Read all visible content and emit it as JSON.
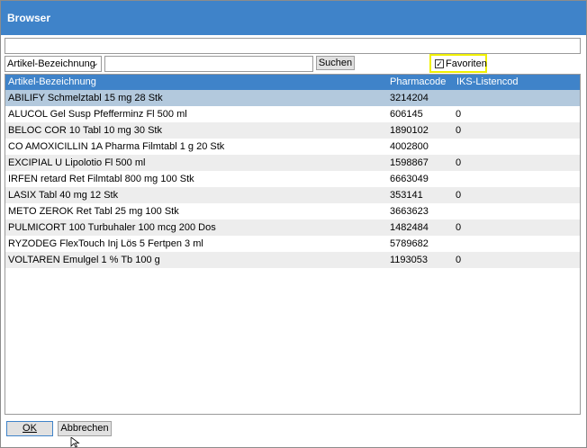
{
  "window": {
    "title": "Browser"
  },
  "top_input": {
    "value": ""
  },
  "filter": {
    "selected": "Artikel-Bezeichnung"
  },
  "search": {
    "value": "",
    "button_label": "Suchen"
  },
  "favorites": {
    "label": "Favoriten",
    "checked": true
  },
  "table": {
    "columns": [
      "Artikel-Bezeichnung",
      "Pharmacode",
      "IKS-Listencode"
    ],
    "rows": [
      [
        "ABILIFY Schmelztabl 15 mg 28 Stk",
        "3214204",
        ""
      ],
      [
        "ALUCOL Gel Susp Pfefferminz Fl 500 ml",
        "606145",
        "0"
      ],
      [
        "BELOC COR 10 Tabl 10 mg 30 Stk",
        "1890102",
        "0"
      ],
      [
        "CO AMOXICILLIN 1A Pharma Filmtabl 1 g 20 Stk",
        "4002800",
        ""
      ],
      [
        "EXCIPIAL U Lipolotio Fl 500 ml",
        "1598867",
        "0"
      ],
      [
        "IRFEN retard Ret Filmtabl 800 mg 100 Stk",
        "6663049",
        ""
      ],
      [
        "LASIX Tabl 40 mg 12 Stk",
        "353141",
        "0"
      ],
      [
        "METO ZEROK Ret Tabl 25 mg 100 Stk",
        "3663623",
        ""
      ],
      [
        "PULMICORT 100 Turbuhaler 100 mcg 200 Dos",
        "1482484",
        "0"
      ],
      [
        "RYZODEG FlexTouch Inj Lös 5 Fertpen 3 ml",
        "5789682",
        ""
      ],
      [
        "VOLTAREN Emulgel 1 % Tb 100 g",
        "1193053",
        "0"
      ]
    ],
    "selected_index": 0
  },
  "footer": {
    "ok_label": "OK",
    "cancel_label": "Abbrechen"
  },
  "icons": {
    "checkbox": "check-icon",
    "dropdown": "chevron-down-icon",
    "cursor": "mouse-pointer-icon"
  }
}
